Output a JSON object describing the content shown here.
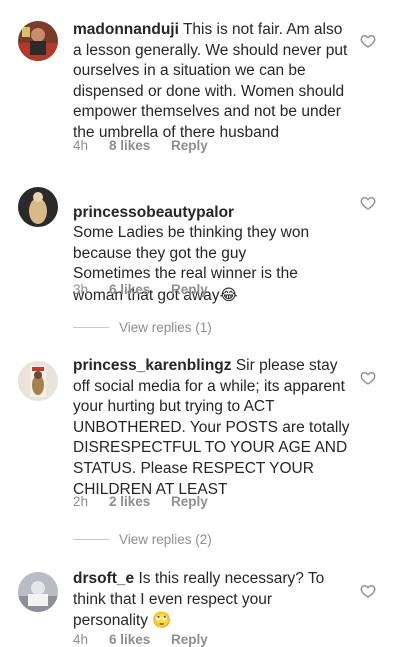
{
  "comments": [
    {
      "username": "madonnanduji",
      "body": "This is not fair. Am also a lesson generally. We should never put ourselves in a situation we can be dispensed or done with. Women should empower themselves and not be under the umbrella of there husband",
      "time": "4h",
      "likes": "8 likes",
      "reply": "Reply"
    },
    {
      "username": "princessobeautypalor",
      "body": "Some Ladies be thinking they won because they got the guy\nSometimes the real winner is the woman that got away",
      "emoji": "😂",
      "time": "3h",
      "likes": "6 likes",
      "reply": "Reply",
      "view_replies": "View replies (1)"
    },
    {
      "username": "princess_karenblingz",
      "body": "Sir please stay off social media for a while; its apparent your hurting but trying to ACT UNBOTHERED. Your POSTS are totally DISRESPECTFUL TO YOUR AGE AND STATUS. Please RESPECT YOUR CHILDREN AT LEAST",
      "time": "2h",
      "likes": "2 likes",
      "reply": "Reply",
      "view_replies": "View replies (2)"
    },
    {
      "username": "drsoft_e",
      "body": "Is this really necessary? To think that I even respect your personality",
      "emoji": "🙄",
      "time": "4h",
      "likes": "6 likes",
      "reply": "Reply"
    }
  ],
  "icons": {
    "like": "heart-outline-icon"
  }
}
